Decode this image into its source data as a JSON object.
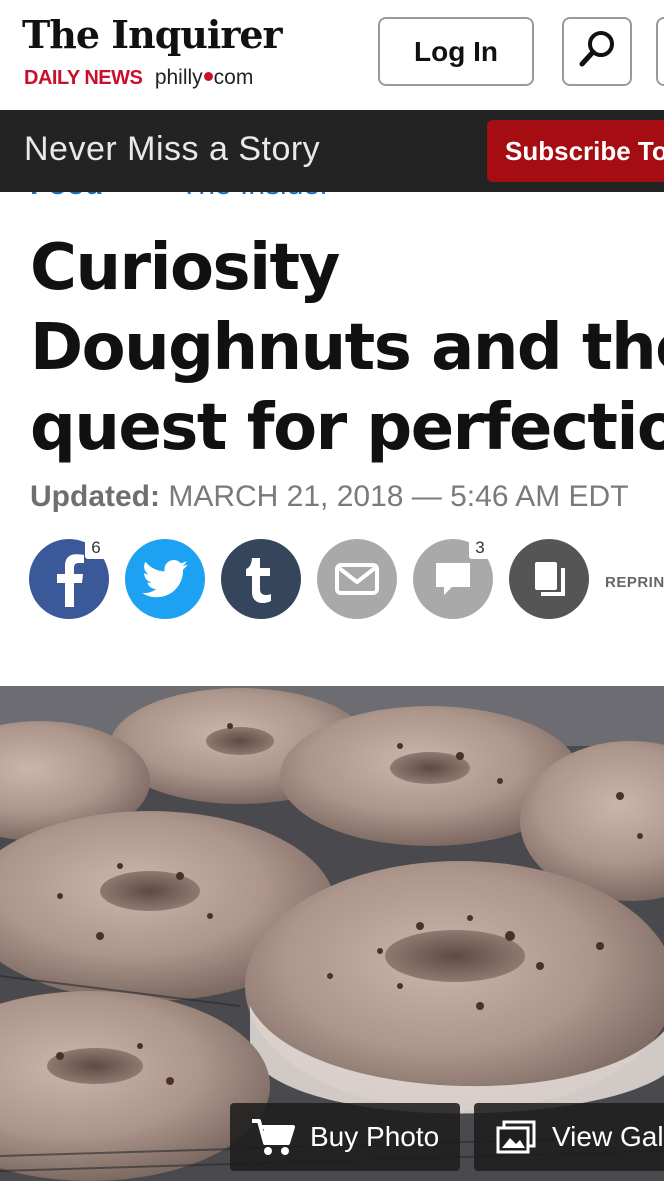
{
  "header": {
    "logo_title": "The Inquirer",
    "logo_daily_news": "DAILY NEWS",
    "logo_philly": "philly",
    "logo_com": "com",
    "login_label": "Log In"
  },
  "subscribe_bar": {
    "text": "Never Miss a Story",
    "button_label": "Subscribe To"
  },
  "breadcrumbs": [
    "Food",
    "The Insider"
  ],
  "article": {
    "headline_lines": [
      "Curiosity",
      "Doughnuts and the",
      "quest for perfectio"
    ],
    "updated_label": "Updated:",
    "updated_value": "MARCH 21, 2018 — 5:46 AM EDT"
  },
  "share": {
    "facebook_count": "6",
    "comments_count": "3",
    "reprints_label": "REPRINT"
  },
  "colors": {
    "facebook": "#3b5998",
    "twitter": "#1da1f2",
    "tumblr": "#35465c",
    "email": "#a9a9a9",
    "comments": "#a9a9a9",
    "copy": "#555555",
    "subscribe": "#a50d12"
  },
  "photo": {
    "buy_label": "Buy Photo",
    "gallery_label": "View Gal"
  }
}
